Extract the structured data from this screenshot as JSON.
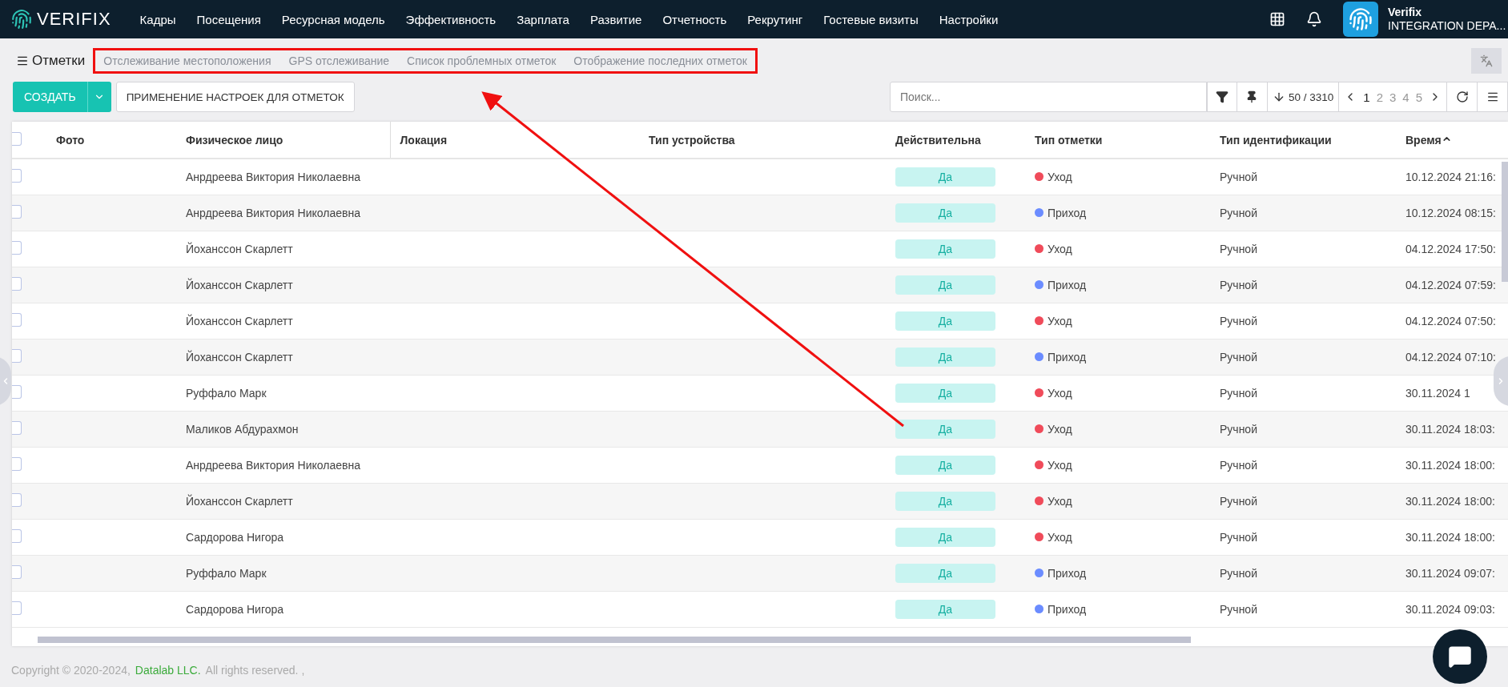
{
  "topbar": {
    "logo": "VERIFIX",
    "menu": [
      "Кадры",
      "Посещения",
      "Ресурсная модель",
      "Эффективность",
      "Зарплата",
      "Развитие",
      "Отчетность",
      "Рекрутинг",
      "Гостевые визиты",
      "Настройки"
    ],
    "user": {
      "name": "Verifix",
      "org": "INTEGRATION DEPA..."
    }
  },
  "page": {
    "title": "Отметки",
    "tabs": [
      "Отслеживание местоположения",
      "GPS отслеживание",
      "Список проблемных отметок",
      "Отображение последних отметок"
    ]
  },
  "toolbar": {
    "create": "СОЗДАТЬ",
    "apply": "ПРИМЕНЕНИЕ НАСТРОЕК ДЛЯ ОТМЕТОК",
    "search": {
      "placeholder": "Поиск..."
    },
    "count": "50 / 3310",
    "pages": [
      {
        "label": "1",
        "selected": true
      },
      {
        "label": "2",
        "selected": false
      },
      {
        "label": "3",
        "selected": false
      },
      {
        "label": "4",
        "selected": false
      },
      {
        "label": "5",
        "selected": false
      }
    ]
  },
  "table": {
    "all_checked": false,
    "columns": [
      "Фото",
      "Физическое лицо",
      "Локация",
      "Тип устройства",
      "Действительна",
      "Тип отметки",
      "Тип идентификации",
      "Время"
    ],
    "rows": [
      {
        "checked": false,
        "person": "Анрдреева Виктория Николаевна",
        "valid": "Да",
        "mark": "Уход",
        "color": "#f04b5a",
        "ident": "Ручной",
        "time": "10.12.2024 21:16:"
      },
      {
        "checked": false,
        "person": "Анрдреева Виктория Николаевна",
        "valid": "Да",
        "mark": "Приход",
        "color": "#6b8cff",
        "ident": "Ручной",
        "time": "10.12.2024 08:15:"
      },
      {
        "checked": false,
        "person": "Йоханссон Скарлетт",
        "valid": "Да",
        "mark": "Уход",
        "color": "#f04b5a",
        "ident": "Ручной",
        "time": "04.12.2024 17:50:"
      },
      {
        "checked": false,
        "person": "Йоханссон Скарлетт",
        "valid": "Да",
        "mark": "Приход",
        "color": "#6b8cff",
        "ident": "Ручной",
        "time": "04.12.2024 07:59:"
      },
      {
        "checked": false,
        "person": "Йоханссон Скарлетт",
        "valid": "Да",
        "mark": "Уход",
        "color": "#f04b5a",
        "ident": "Ручной",
        "time": "04.12.2024 07:50:"
      },
      {
        "checked": false,
        "person": "Йоханссон Скарлетт",
        "valid": "Да",
        "mark": "Приход",
        "color": "#6b8cff",
        "ident": "Ручной",
        "time": "04.12.2024 07:10:"
      },
      {
        "checked": false,
        "person": "Руффало Марк",
        "valid": "Да",
        "mark": "Уход",
        "color": "#f04b5a",
        "ident": "Ручной",
        "time": "30.11.2024 1"
      },
      {
        "checked": false,
        "person": "Маликов Абдурахмон",
        "valid": "Да",
        "mark": "Уход",
        "color": "#f04b5a",
        "ident": "Ручной",
        "time": "30.11.2024 18:03:"
      },
      {
        "checked": false,
        "person": "Анрдреева Виктория Николаевна",
        "valid": "Да",
        "mark": "Уход",
        "color": "#f04b5a",
        "ident": "Ручной",
        "time": "30.11.2024 18:00:"
      },
      {
        "checked": false,
        "person": "Йоханссон Скарлетт",
        "valid": "Да",
        "mark": "Уход",
        "color": "#f04b5a",
        "ident": "Ручной",
        "time": "30.11.2024 18:00:"
      },
      {
        "checked": false,
        "person": "Сардорова Нигора",
        "valid": "Да",
        "mark": "Уход",
        "color": "#f04b5a",
        "ident": "Ручной",
        "time": "30.11.2024 18:00:"
      },
      {
        "checked": false,
        "person": "Руффало Марк",
        "valid": "Да",
        "mark": "Приход",
        "color": "#6b8cff",
        "ident": "Ручной",
        "time": "30.11.2024 09:07:"
      },
      {
        "checked": false,
        "person": "Сардорова Нигора",
        "valid": "Да",
        "mark": "Приход",
        "color": "#6b8cff",
        "ident": "Ручной",
        "time": "30.11.2024 09:03:"
      }
    ]
  },
  "footer": {
    "copyright": "Copyright © 2020-2024,",
    "company": "Datalab LLC.",
    "rights": "All rights reserved. ,"
  }
}
